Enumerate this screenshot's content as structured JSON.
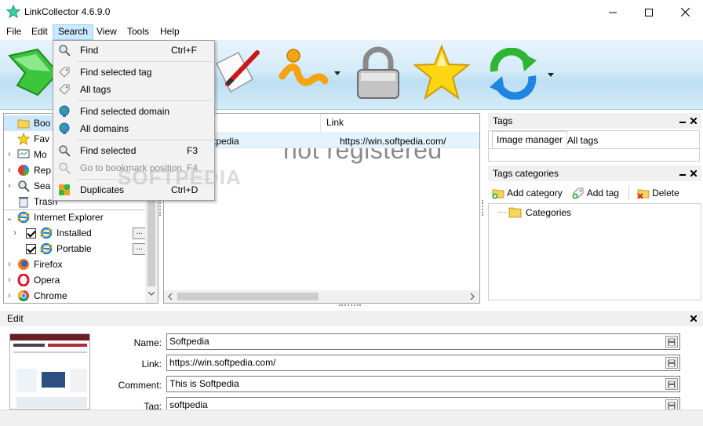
{
  "window": {
    "title": "LinkCollector 4.6.9.0",
    "controls": [
      "minimize",
      "maximize",
      "close"
    ]
  },
  "menubar": {
    "items": [
      "File",
      "Edit",
      "Search",
      "View",
      "Tools",
      "Help"
    ],
    "active": "Search"
  },
  "search_menu": {
    "items": [
      {
        "label": "Find",
        "shortcut": "Ctrl+F",
        "icon": "magnifier-icon",
        "enabled": true
      },
      {
        "label": "Find selected tag",
        "shortcut": "",
        "icon": "tag-icon",
        "enabled": true
      },
      {
        "label": "All tags",
        "shortcut": "",
        "icon": "tags-icon",
        "enabled": true
      },
      {
        "label": "Find selected domain",
        "shortcut": "",
        "icon": "globe-icon",
        "enabled": true
      },
      {
        "label": "All domains",
        "shortcut": "",
        "icon": "globe-icon",
        "enabled": true
      },
      {
        "label": "Find selected",
        "shortcut": "F3",
        "icon": "magnifier-icon",
        "enabled": true
      },
      {
        "label": "Go to bookmark position",
        "shortcut": "F4",
        "icon": "magnifier-icon",
        "enabled": false
      },
      {
        "label": "Duplicates",
        "shortcut": "Ctrl+D",
        "icon": "duplicates-icon",
        "enabled": true
      }
    ]
  },
  "tree": {
    "items": [
      {
        "label": "Boo",
        "icon": "folder-icon",
        "selected": true
      },
      {
        "label": "Fav",
        "icon": "star-icon"
      },
      {
        "label": "Mo",
        "icon": "monitor-icon"
      },
      {
        "label": "Rep",
        "icon": "pie-icon"
      },
      {
        "label": "Sea",
        "icon": "magnifier-icon"
      },
      {
        "label": "Trash",
        "icon": "trash-icon"
      },
      {
        "label": "Internet Explorer",
        "icon": "ie-icon"
      },
      {
        "label": "Installed",
        "icon": "ie-icon",
        "checked": true
      },
      {
        "label": "Portable",
        "icon": "ie-icon",
        "checked": true
      },
      {
        "label": "Firefox",
        "icon": "firefox-icon"
      },
      {
        "label": "Opera",
        "icon": "opera-icon"
      },
      {
        "label": "Chrome",
        "icon": "chrome-icon"
      }
    ],
    "ellipsis": "..."
  },
  "list": {
    "columns": [
      "",
      "Link"
    ],
    "rows": [
      {
        "name": "tpedia",
        "link": "https://win.softpedia.com/"
      }
    ],
    "watermark": "not registered"
  },
  "tags_panel": {
    "title": "Tags",
    "tabs": [
      "Image manager",
      "All tags"
    ]
  },
  "categories_panel": {
    "title": "Tags categories",
    "buttons": [
      "Add category",
      "Add tag",
      "Delete"
    ],
    "root": "Categories"
  },
  "edit_panel": {
    "title": "Edit",
    "fields": [
      {
        "label": "Name:",
        "value": "Softpedia"
      },
      {
        "label": "Link:",
        "value": "https://win.softpedia.com/"
      },
      {
        "label": "Comment:",
        "value": "This is Softpedia"
      },
      {
        "label": "Tag:",
        "value": "softpedia"
      }
    ]
  },
  "watermark_text": "SOFTPEDIA",
  "colors": {
    "menu_highlight": "#cce8ff",
    "selection": "#e5f3ff",
    "toolbar_bg": "#d4ebf8"
  }
}
